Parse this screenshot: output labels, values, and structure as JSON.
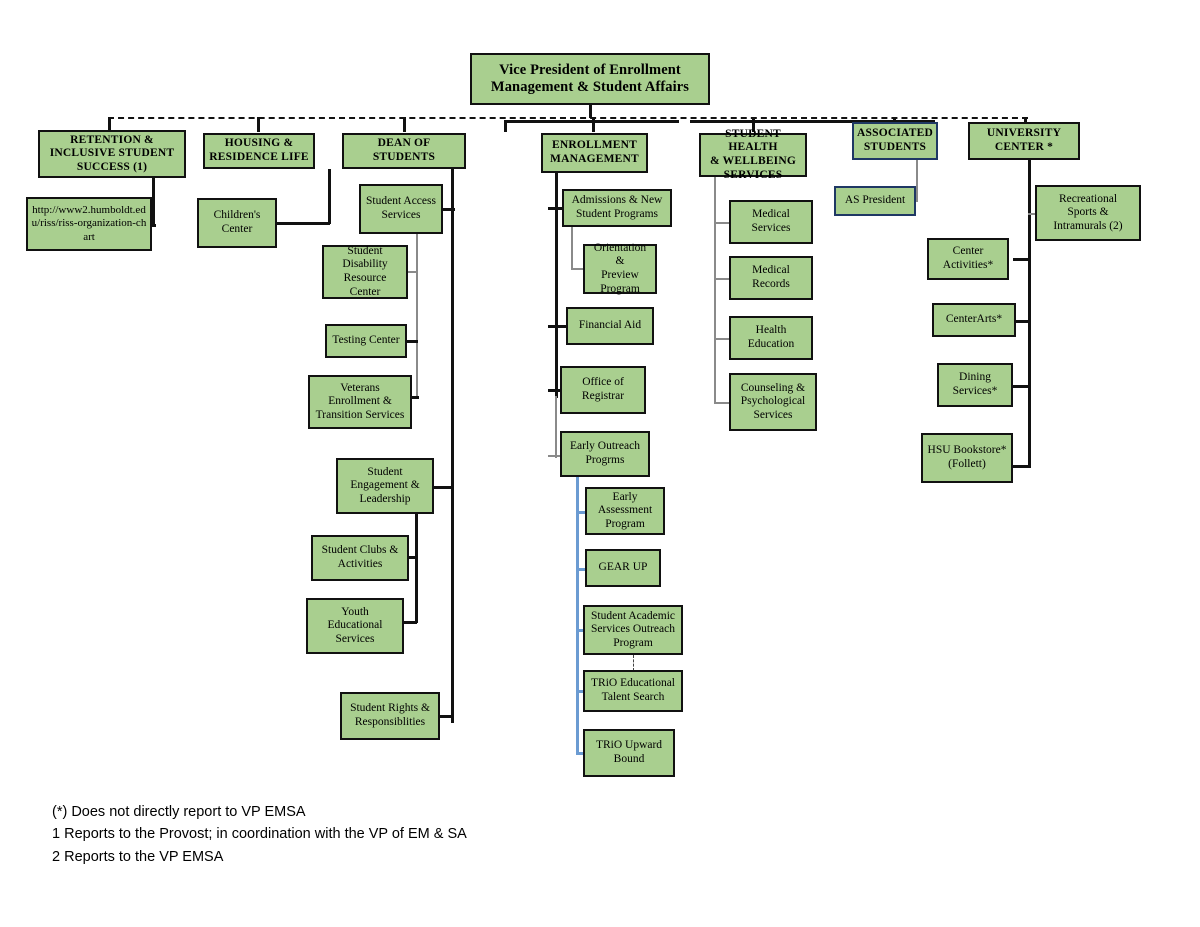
{
  "chart": {
    "title": "Vice President of Enrollment Management & Student Affairs org chart",
    "colors": {
      "box_fill": "#a9cf8f",
      "box_border": "#111111",
      "blue_border": "#1f3864",
      "blue_connector": "#6b9bd2",
      "gray_connector": "#8a8a8a",
      "background": "#ffffff"
    }
  },
  "root": {
    "label": "Vice President of Enrollment\nManagement & Student Affairs"
  },
  "divisions": [
    {
      "label": "RETENTION &\nINCLUSIVE STUDENT\nSUCCESS (1)"
    },
    {
      "label": "HOUSING &\nRESIDENCE LIFE"
    },
    {
      "label": "DEAN OF STUDENTS"
    },
    {
      "label": "ENROLLMENT\nMANAGEMENT"
    },
    {
      "label": "STUDENT HEALTH\n& WELLBEING\nSERVICES"
    },
    {
      "label": "ASSOCIATED\nSTUDENTS"
    },
    {
      "label": "UNIVERSITY\nCENTER *"
    }
  ],
  "retention": {
    "url_box": "http://www2.humboldt.edu/riss/riss-organization-chart"
  },
  "housing": {
    "children": [
      {
        "label": "Children's\nCenter"
      }
    ]
  },
  "dean_of_students": {
    "children": [
      {
        "label": "Student Access\nServices"
      },
      {
        "label": "Student\nDisability\nResource Center"
      },
      {
        "label": "Testing Center"
      },
      {
        "label": "Veterans\nEnrollment &\nTransition Services"
      },
      {
        "label": "Student\nEngagement &\nLeadership"
      },
      {
        "label": "Student Clubs &\nActivities"
      },
      {
        "label": "Youth\nEducational\nServices"
      },
      {
        "label": "Student Rights &\nResponsiblities"
      }
    ]
  },
  "enrollment_management": {
    "children": [
      {
        "label": "Admissions & New\nStudent Programs"
      },
      {
        "label": "Financial Aid"
      },
      {
        "label": "Office of\nRegistrar"
      },
      {
        "label": "Early Outreach\nProgrms"
      }
    ],
    "admissions_child": {
      "label": "Orientation &\nPreview\nProgram"
    },
    "early_outreach_children": [
      {
        "label": "Early\nAssessment\nProgram"
      },
      {
        "label": "GEAR UP"
      },
      {
        "label": "Student Academic\nServices Outreach\nProgram"
      },
      {
        "label": "TRiO Educational\nTalent Search"
      },
      {
        "label": "TRiO Upward\nBound"
      }
    ]
  },
  "student_health": {
    "children": [
      {
        "label": "Medical\nServices"
      },
      {
        "label": "Medical\nRecords"
      },
      {
        "label": "Health\nEducation"
      },
      {
        "label": "Counseling &\nPsychological\nServices"
      }
    ]
  },
  "associated_students": {
    "children": [
      {
        "label": "AS President"
      }
    ]
  },
  "university_center": {
    "right_child": {
      "label": "Recreational\nSports &\nIntramurals (2)"
    },
    "left_children": [
      {
        "label": "Center\nActivities*"
      },
      {
        "label": "CenterArts*"
      },
      {
        "label": "Dining\nServices*"
      },
      {
        "label": "HSU Bookstore*\n(Follett)"
      }
    ]
  },
  "footnotes": {
    "line1": "(*) Does not directly report to VP EMSA",
    "line2": "1 Reports to the Provost; in coordination with the VP of EM & SA",
    "line3": "2 Reports to the VP EMSA"
  }
}
